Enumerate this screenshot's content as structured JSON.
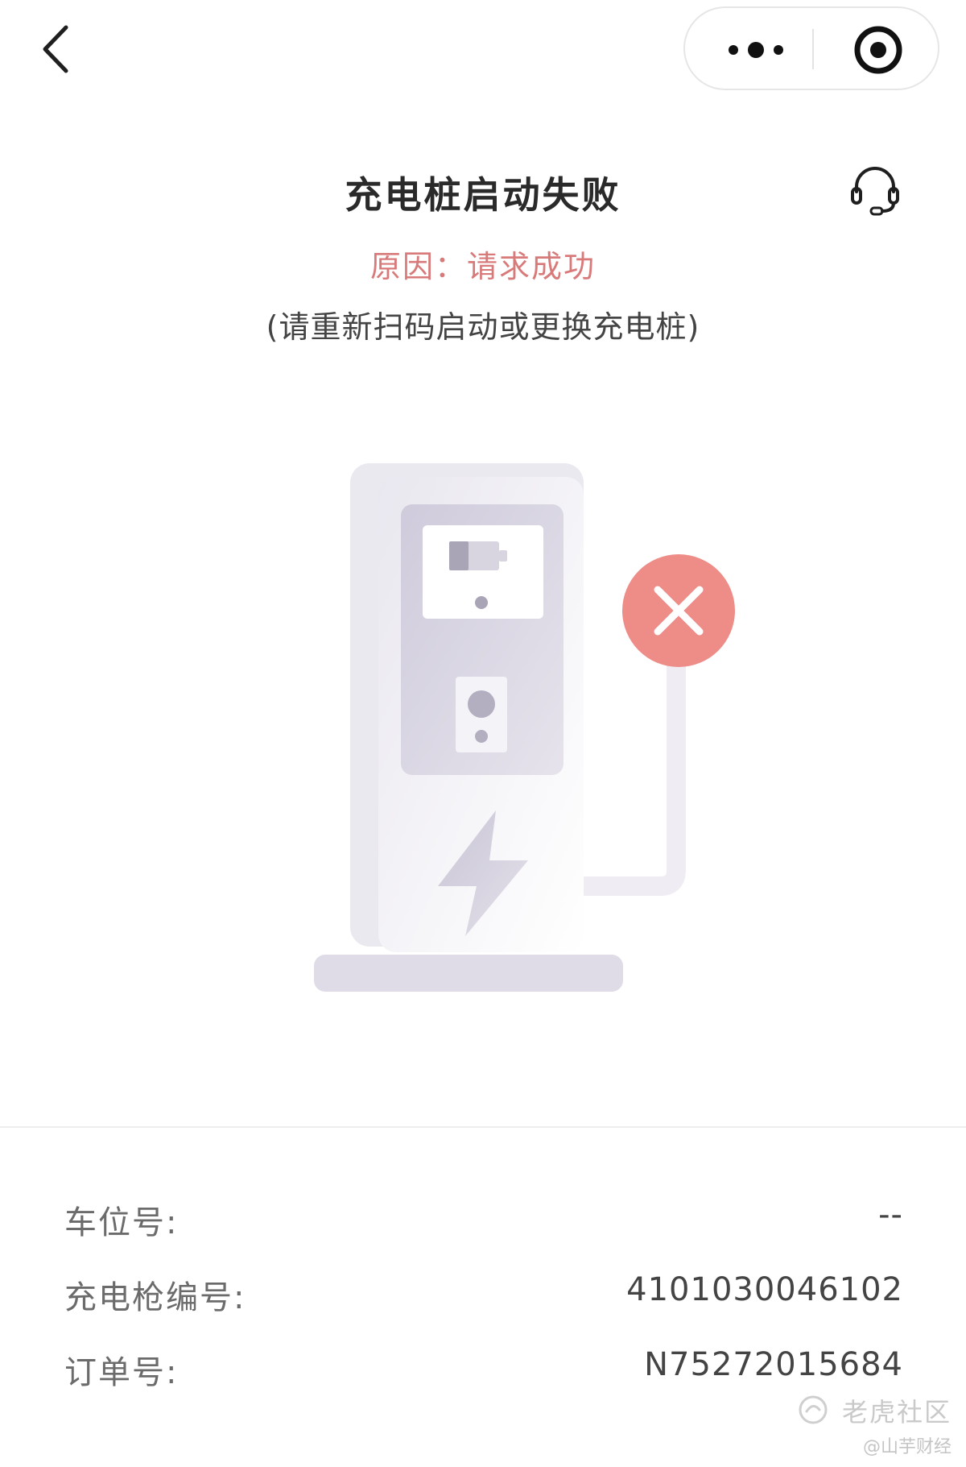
{
  "nav": {
    "back_icon": "chevron-left-icon",
    "more_icon": "more-dots-icon",
    "close_icon": "target-close-icon"
  },
  "header": {
    "title": "充电桩启动失败",
    "support_icon": "headset-icon",
    "reason": "原因：请求成功",
    "hint": "(请重新扫码启动或更换充电桩)"
  },
  "illustration": {
    "icons": [
      "charging-station-icon",
      "error-x-icon",
      "lightning-icon",
      "battery-icon"
    ]
  },
  "details": [
    {
      "label": "车位号:",
      "value": "--"
    },
    {
      "label": "充电枪编号:",
      "value": "4101030046102"
    },
    {
      "label": "订单号:",
      "value": "N75272015684"
    }
  ],
  "watermark": {
    "main": "老虎社区",
    "sub": "@山芋财经"
  },
  "colors": {
    "error_red": "#ee8c88",
    "reason_text": "#d97a7a",
    "illustration_gray": "#dedbe6"
  }
}
